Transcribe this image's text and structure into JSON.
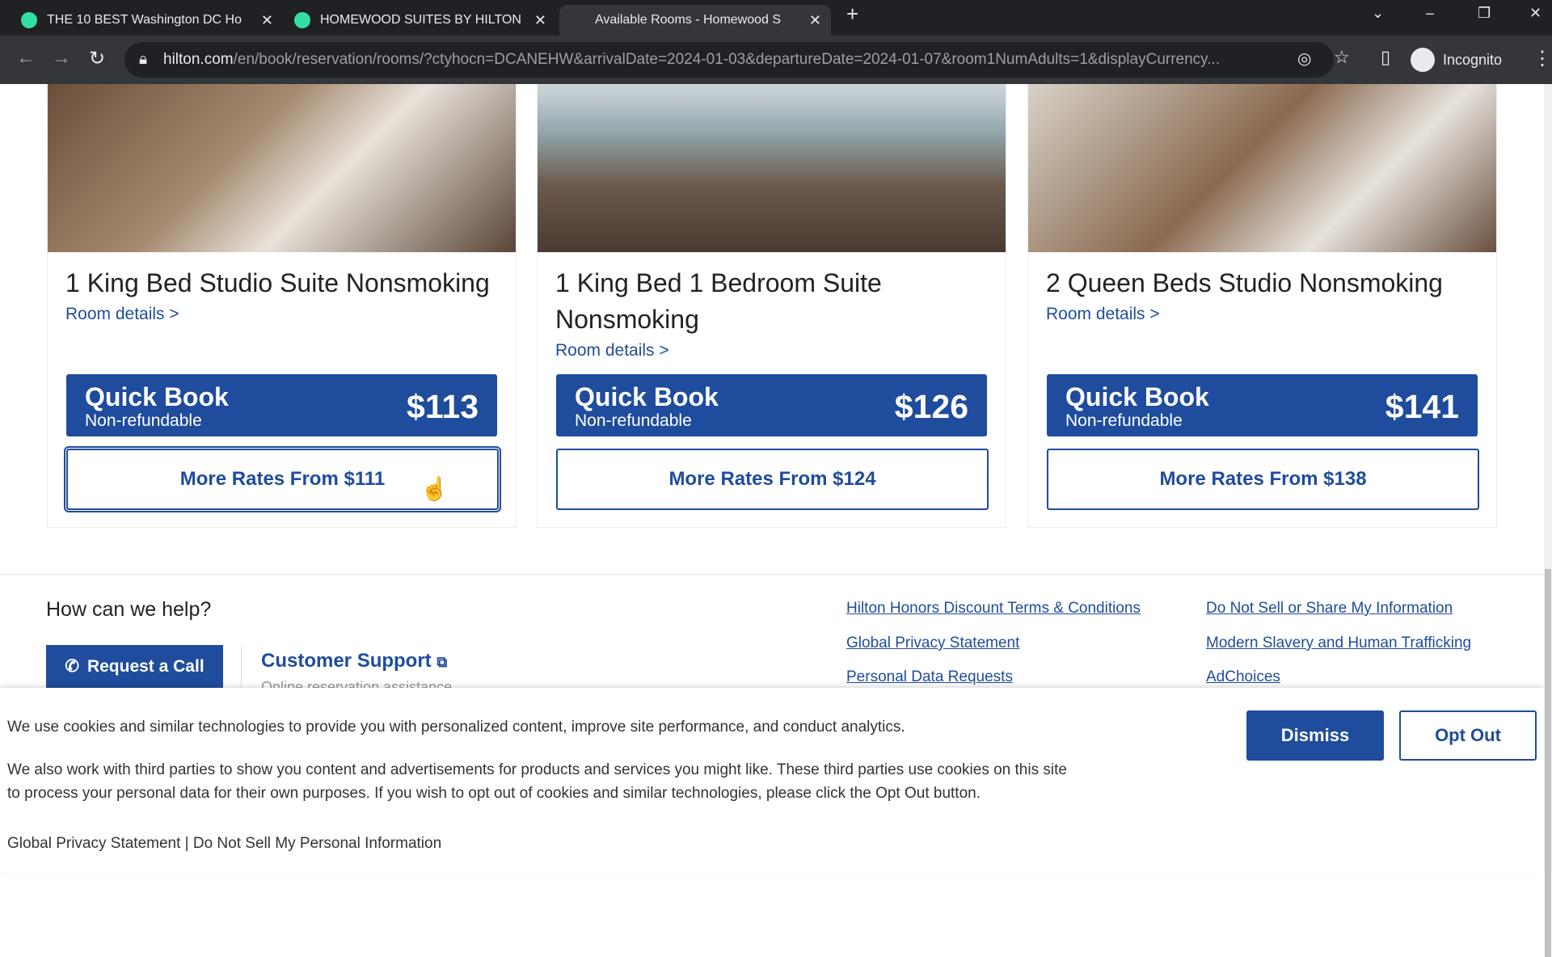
{
  "browser": {
    "tabs": [
      {
        "title": "THE 10 BEST Washington DC Ho",
        "icon": "tripadvisor-icon"
      },
      {
        "title": "HOMEWOOD SUITES BY HILTON",
        "icon": "tripadvisor-icon"
      },
      {
        "title": "Available Rooms - Homewood S",
        "icon": "hilton-icon"
      }
    ],
    "url_domain": "hilton.com",
    "url_path": "/en/book/reservation/rooms/?ctyhocn=DCANEHW&arrivalDate=2024-01-03&departureDate=2024-01-07&room1NumAdults=1&displayCurrency...",
    "profile": "Incognito"
  },
  "rooms": [
    {
      "name": "1 King Bed Studio Suite Nonsmoking",
      "details": "Room details >",
      "quick_book": "Quick Book",
      "rate_type": "Non-refundable",
      "price": "$113",
      "more_rates": "More Rates From $111"
    },
    {
      "name": "1 King Bed 1 Bedroom Suite Nonsmoking",
      "details": "Room details >",
      "quick_book": "Quick Book",
      "rate_type": "Non-refundable",
      "price": "$126",
      "more_rates": "More Rates From $124"
    },
    {
      "name": "2 Queen Beds Studio Nonsmoking",
      "details": "Room details >",
      "quick_book": "Quick Book",
      "rate_type": "Non-refundable",
      "price": "$141",
      "more_rates": "More Rates From $138"
    }
  ],
  "footer": {
    "help_title": "How can we help?",
    "request_call": "Request a Call",
    "customer_support": "Customer Support",
    "customer_support_sub": "Online reservation assistance",
    "links": [
      "Hilton Honors Discount Terms & Conditions",
      "Global Privacy Statement",
      "Personal Data Requests",
      "Do Not Sell or Share My Information",
      "Modern Slavery and Human Trafficking",
      "AdChoices"
    ]
  },
  "cookie": {
    "line1": "We use cookies and similar technologies to provide you with personalized content, improve site performance, and conduct analytics.",
    "line2": "We also work with third parties to show you content and advertisements for products and services you might like. These third parties use cookies on this site to process your personal data for their own purposes. If you wish to opt out of cookies and similar technologies, please click the Opt Out button.",
    "links": "Global Privacy Statement | Do Not Sell My Personal Information",
    "dismiss": "Dismiss",
    "opt_out": "Opt Out"
  },
  "colors": {
    "brand": "#1f4c9c"
  }
}
